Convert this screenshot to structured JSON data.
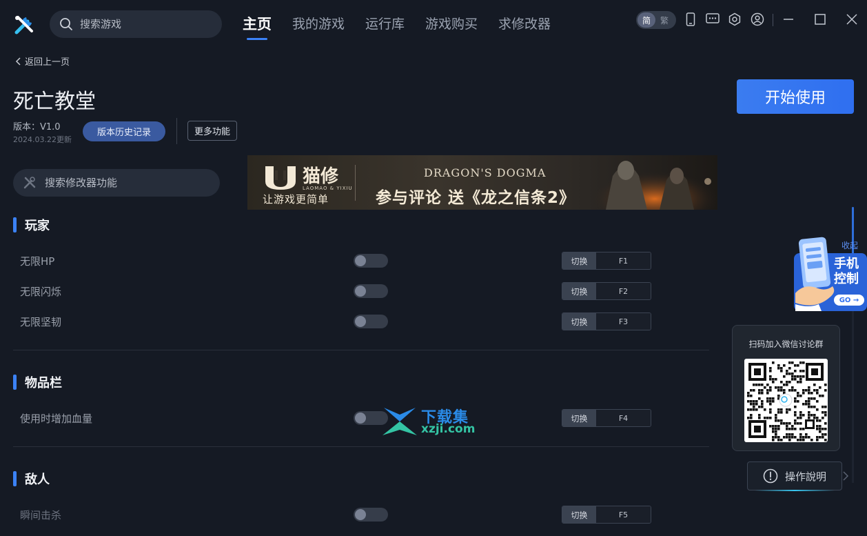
{
  "header": {
    "search_placeholder": "搜索游戏",
    "nav": [
      "主页",
      "我的游戏",
      "运行库",
      "游戏购买",
      "求修改器"
    ],
    "lang": {
      "simplified": "简",
      "traditional": "繁"
    },
    "icons": [
      "phone-icon",
      "chat-icon",
      "gear-icon",
      "user-icon",
      "minimize-icon",
      "maximize-icon",
      "close-icon"
    ]
  },
  "page": {
    "back_label": "返回上一页",
    "title": "死亡教堂",
    "version": "版本：V1.0",
    "updated": "2024.03.22更新",
    "history_button": "版本历史记录",
    "more_button": "更多功能",
    "start_button": "开始使用",
    "feature_search_placeholder": "搜索修改器功能"
  },
  "banner": {
    "brand": "猫修",
    "brand_sub": "LAOMAO & YIXIU",
    "slogan": "让游戏更简单",
    "game_logo": "DRAGON'S DOGMA",
    "promo": "参与评论 送《龙之信条2》"
  },
  "sections": [
    {
      "title": "玩家",
      "features": [
        {
          "name": "无限HP",
          "mode": "切换",
          "key": "F1",
          "enabled": false
        },
        {
          "name": "无限闪烁",
          "mode": "切换",
          "key": "F2",
          "enabled": false
        },
        {
          "name": "无限坚韧",
          "mode": "切换",
          "key": "F3",
          "enabled": false
        }
      ]
    },
    {
      "title": "物品栏",
      "features": [
        {
          "name": "使用时增加血量",
          "mode": "切换",
          "key": "F4",
          "enabled": false
        }
      ]
    },
    {
      "title": "敌人",
      "features": [
        {
          "name": "瞬间击杀",
          "mode": "切换",
          "key": "F5",
          "enabled": false
        }
      ]
    }
  ],
  "side": {
    "collapse": "收起",
    "phone_control": "手机控制",
    "go": "GO →",
    "qr_caption": "扫码加入微信讨论群",
    "help": "操作說明"
  },
  "watermark": {
    "cn": "下载集",
    "en": "xzji.com"
  },
  "colors": {
    "accent": "#3b82f6",
    "bg": "#151a24",
    "panel": "#262d3a"
  }
}
